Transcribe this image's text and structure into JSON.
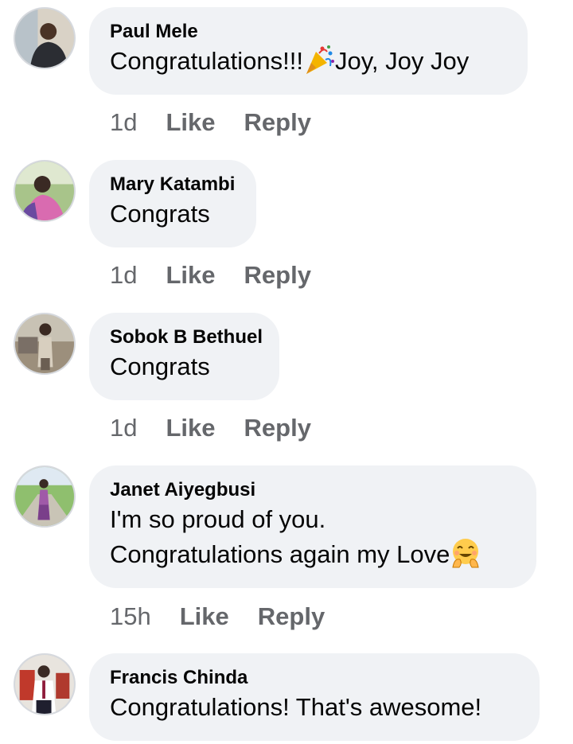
{
  "comments": [
    {
      "author": "Paul Mele",
      "text_before": "Congratulations!!!",
      "emoji": "party-popper-icon",
      "text_after": "Joy, Joy Joy",
      "time": "1d",
      "like": "Like",
      "reply": "Reply"
    },
    {
      "author": "Mary Katambi",
      "text": "Congrats",
      "time": "1d",
      "like": "Like",
      "reply": "Reply"
    },
    {
      "author": "Sobok B Bethuel",
      "text": "Congrats",
      "time": "1d",
      "like": "Like",
      "reply": "Reply"
    },
    {
      "author": "Janet Aiyegbusi",
      "text_line1": "I'm so proud of you.",
      "text_line2": "Congratulations again my Love",
      "emoji": "smiling-face-with-open-hands-icon",
      "time": "15h",
      "like": "Like",
      "reply": "Reply"
    },
    {
      "author": "Francis Chinda",
      "text": "Congratulations! That's awesome!"
    }
  ],
  "colors": {
    "bubble": "#f0f2f5",
    "text": "#050505",
    "meta": "#65676b"
  }
}
